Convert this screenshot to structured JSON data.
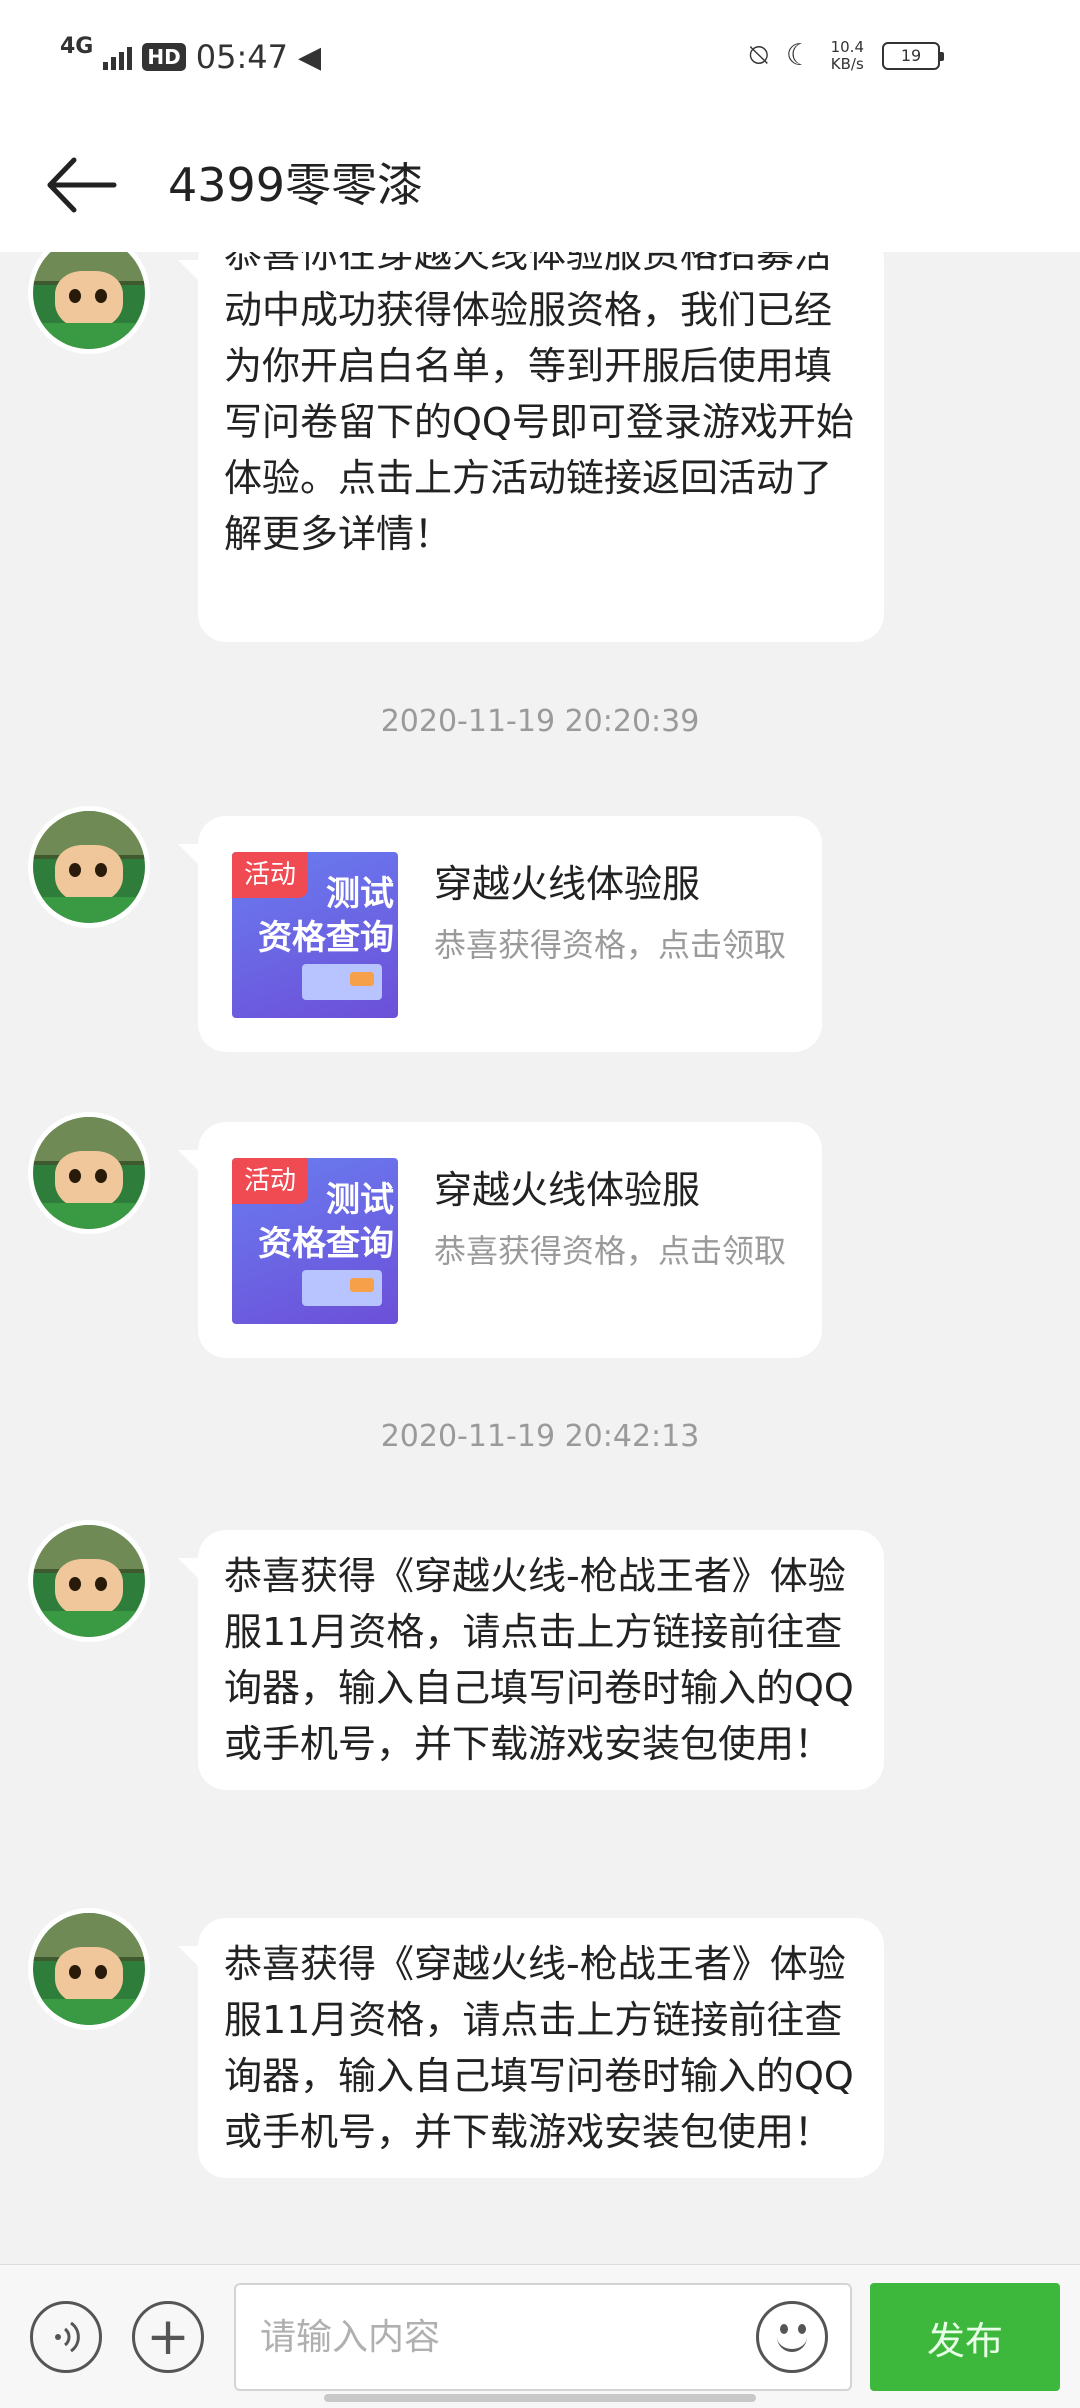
{
  "status_bar": {
    "network": "4G",
    "hd": "HD",
    "time": "05:47",
    "speed_value": "10.4",
    "speed_unit": "KB/s",
    "battery": "19"
  },
  "header": {
    "title": "4399零零漆"
  },
  "messages": {
    "msg1_text": "恭喜你在穿越火线体验服资格招募活动中成功获得体验服资格，我们已经为你开启白名单，等到开服后使用填写问卷留下的QQ号即可登录游戏开始体验。点击上方活动链接返回活动了解更多详情！",
    "timestamp1": "2020-11-19 20:20:39",
    "card1": {
      "tag": "活动",
      "thumb_text": "测试\n资格查询",
      "title": "穿越火线体验服",
      "desc": "恭喜获得资格，点击领取"
    },
    "card2": {
      "tag": "活动",
      "thumb_text": "测试\n资格查询",
      "title": "穿越火线体验服",
      "desc": "恭喜获得资格，点击领取"
    },
    "timestamp2": "2020-11-19 20:42:13",
    "msg2_text": "恭喜获得《穿越火线-枪战王者》体验服11月资格，请点击上方链接前往查询器，输入自己填写问卷时输入的QQ或手机号，并下载游戏安装包使用！",
    "msg3_text": "恭喜获得《穿越火线-枪战王者》体验服11月资格，请点击上方链接前往查询器，输入自己填写问卷时输入的QQ或手机号，并下载游戏安装包使用！"
  },
  "input_bar": {
    "placeholder": "请输入内容",
    "send_label": "发布"
  },
  "colors": {
    "send_button": "#3db83c",
    "background": "#f2f2f2",
    "activity_tag": "#f04a52"
  },
  "icons": [
    "back-arrow-icon",
    "voice-icon",
    "plus-icon",
    "emoji-icon",
    "mute-icon",
    "dnd-moon-icon",
    "bell-off-icon"
  ]
}
